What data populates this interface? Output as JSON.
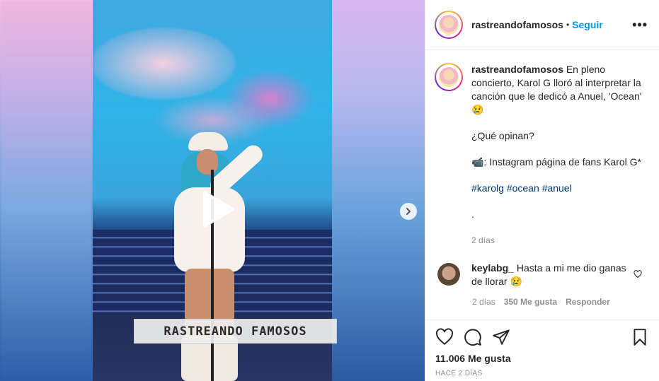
{
  "header": {
    "username": "rastreandofamosos",
    "separator": "•",
    "follow_label": "Seguir",
    "more_label": "•••"
  },
  "media": {
    "watermark": "RASTREANDO FAMOSOS",
    "play_icon": "play-icon",
    "next_icon": "chevron-right-icon"
  },
  "caption": {
    "username": "rastreandofamosos",
    "line1": "En pleno concierto, Karol G lloró al interpretar la canción que le dedicó a Anuel, 'Ocean' 😢",
    "line2": "¿Qué opinan?",
    "line3": "📹: Instagram página de fans Karol G*",
    "hashtags": [
      "#karolg",
      "#ocean",
      "#anuel"
    ],
    "line5": ".",
    "time": "2 días"
  },
  "comments": [
    {
      "username": "keylabg_",
      "text": "Hasta a mi me dio ganas de llorar 😢",
      "time": "2 días",
      "likes": "350 Me gusta",
      "reply_label": "Responder"
    }
  ],
  "actions": {
    "likes": "11.006 Me gusta",
    "date": "HACE 2 DÍAS"
  },
  "colors": {
    "accent": "#0095f6",
    "text": "#262626",
    "muted": "#8e8e8e",
    "hashtag": "#00376b"
  }
}
